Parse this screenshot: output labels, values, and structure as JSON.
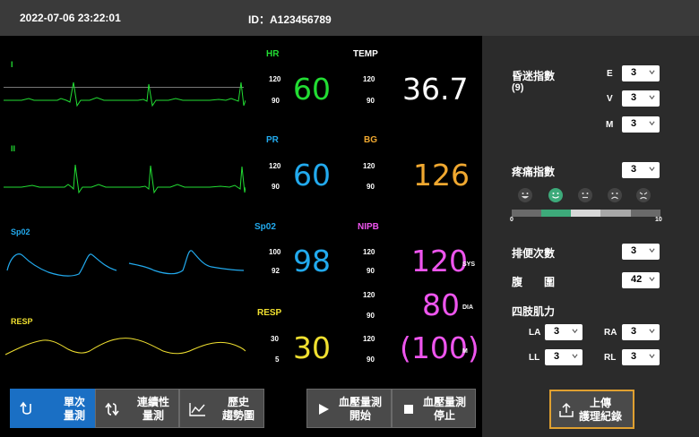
{
  "header": {
    "datetime": "2022-07-06  23:22:01",
    "patient_id": "ID：A123456789"
  },
  "waveforms": {
    "ecg1_label": "I",
    "ecg2_label": "II",
    "spo2_label": "Sp02",
    "resp_label": "RESP"
  },
  "vitals": {
    "hr": {
      "label": "HR",
      "hi": "120",
      "lo": "90",
      "value": "60",
      "color": "#22dd33"
    },
    "temp": {
      "label": "TEMP",
      "hi": "120",
      "lo": "90",
      "value": "36.7",
      "color": "#ffffff"
    },
    "pr": {
      "label": "PR",
      "hi": "120",
      "lo": "90",
      "value": "60",
      "color": "#22aaee"
    },
    "bg": {
      "label": "BG",
      "hi": "120",
      "lo": "90",
      "value": "126",
      "color": "#f0a830"
    },
    "spo2": {
      "label": "Sp02",
      "hi": "100",
      "lo": "92",
      "value": "98",
      "color": "#22aaee"
    },
    "nipb": {
      "label": "NIPB",
      "color": "#ee55ee",
      "sys": {
        "hi": "120",
        "lo": "90",
        "value": "120",
        "unit": "SYS"
      },
      "dia": {
        "hi": "120",
        "lo": "90",
        "value": "80",
        "unit": "DIA"
      },
      "m": {
        "hi": "120",
        "lo": "90",
        "value": "(100)",
        "unit": "M"
      }
    },
    "resp": {
      "label": "RESP",
      "hi": "30",
      "lo": "5",
      "value": "30",
      "color": "#f0e030"
    }
  },
  "buttons": {
    "single": [
      "單次",
      "量測"
    ],
    "continuous": [
      "連續性",
      "量測"
    ],
    "history": [
      "歷史",
      "趨勢圖"
    ],
    "bp_start": [
      "血壓量測",
      "開始"
    ],
    "bp_stop": [
      "血壓量測",
      "停止"
    ]
  },
  "panel": {
    "coma_label": "昏迷指數",
    "coma_total": "(9)",
    "coma_e_label": "E",
    "coma_e": "3",
    "coma_v_label": "V",
    "coma_v": "3",
    "coma_m_label": "M",
    "coma_m": "3",
    "pain_label": "疼痛指數",
    "pain_value": "3",
    "pain_min": "0",
    "pain_max": "10",
    "bowel_label": "排便次數",
    "bowel_value": "3",
    "abdomen_label": "腹　　圍",
    "abdomen_value": "42",
    "limb_label": "四肢肌力",
    "la_label": "LA",
    "la_value": "3",
    "ra_label": "RA",
    "ra_value": "3",
    "ll_label": "LL",
    "ll_value": "3",
    "rl_label": "RL",
    "rl_value": "3",
    "upload": [
      "上傳",
      "護理紀錄"
    ]
  }
}
